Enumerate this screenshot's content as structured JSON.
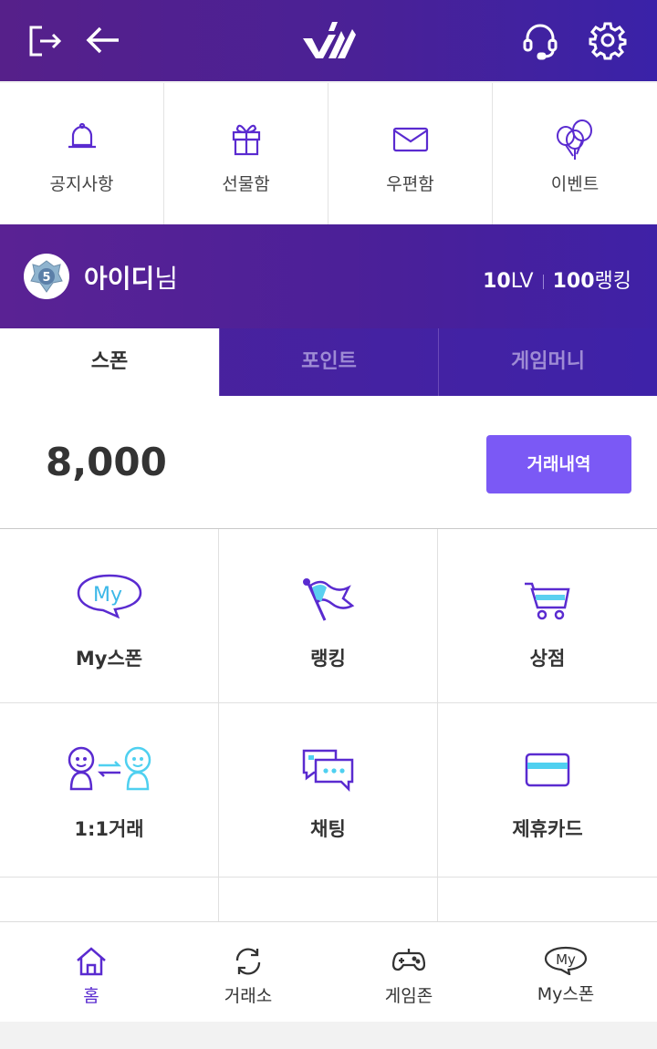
{
  "header": {
    "logout_icon": "logout-icon",
    "back_icon": "back-arrow-icon",
    "logo": "ws-logo",
    "support_icon": "headset-icon",
    "settings_icon": "gear-icon"
  },
  "quick_menu": [
    {
      "label": "공지사항",
      "icon": "bell-icon"
    },
    {
      "label": "선물함",
      "icon": "gift-icon"
    },
    {
      "label": "우편함",
      "icon": "mail-icon"
    },
    {
      "label": "이벤트",
      "icon": "balloons-icon"
    }
  ],
  "profile": {
    "name": "아이디",
    "suffix": "님",
    "level_num": "10",
    "level_unit": "LV",
    "rank_num": "100",
    "rank_unit": "랭킹",
    "badge_number": "5"
  },
  "tabs": [
    {
      "label": "스폰",
      "active": true
    },
    {
      "label": "포인트",
      "active": false
    },
    {
      "label": "게임머니",
      "active": false
    }
  ],
  "balance": {
    "amount": "8,000",
    "history_button": "거래내역"
  },
  "grid_menu": [
    {
      "label": "My스폰",
      "icon": "my-speech-bubble-icon",
      "icon_text": "My"
    },
    {
      "label": "랭킹",
      "icon": "flag-icon"
    },
    {
      "label": "상점",
      "icon": "cart-icon"
    },
    {
      "label": "1:1거래",
      "icon": "trade-people-icon"
    },
    {
      "label": "채팅",
      "icon": "chat-icon"
    },
    {
      "label": "제휴카드",
      "icon": "card-icon"
    }
  ],
  "bottom_nav": [
    {
      "label": "홈",
      "icon": "home-icon",
      "active": true
    },
    {
      "label": "거래소",
      "icon": "exchange-icon",
      "active": false
    },
    {
      "label": "게임존",
      "icon": "gamepad-icon",
      "active": false
    },
    {
      "label": "My스폰",
      "icon": "my-bubble-icon",
      "icon_text": "My",
      "active": false
    }
  ],
  "colors": {
    "accent": "#7b59f5",
    "header_purple": "#4a2196",
    "icon_purple": "#5a2bd0",
    "icon_cyan": "#4fd0f0"
  }
}
